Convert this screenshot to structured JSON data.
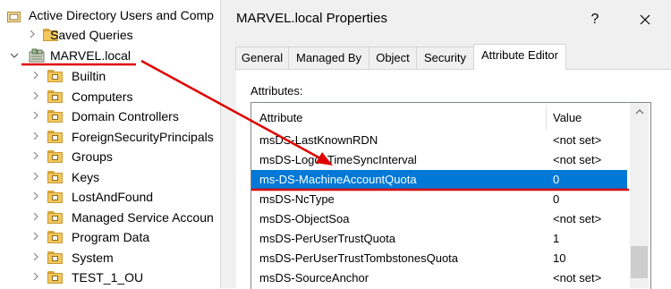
{
  "tree": {
    "root_label": "Active Directory Users and Comp",
    "saved_queries_label": "Saved Queries",
    "domain_label": "MARVEL.local",
    "children": [
      {
        "label": "Builtin"
      },
      {
        "label": "Computers"
      },
      {
        "label": "Domain Controllers"
      },
      {
        "label": "ForeignSecurityPrincipals"
      },
      {
        "label": "Groups"
      },
      {
        "label": "Keys"
      },
      {
        "label": "LostAndFound"
      },
      {
        "label": "Managed Service Accoun"
      },
      {
        "label": "Program Data"
      },
      {
        "label": "System"
      },
      {
        "label": "TEST_1_OU"
      }
    ]
  },
  "dialog": {
    "title": "MARVEL.local Properties",
    "help_label": "?",
    "tabs": [
      {
        "label": "General"
      },
      {
        "label": "Managed By"
      },
      {
        "label": "Object"
      },
      {
        "label": "Security"
      },
      {
        "label": "Attribute Editor"
      }
    ],
    "attributes_caption": "Attributes:",
    "columns": {
      "attribute": "Attribute",
      "value": "Value"
    },
    "rows": [
      {
        "attribute": "msDS-LastKnownRDN",
        "value": "<not set>"
      },
      {
        "attribute": "msDS-LogonTimeSyncInterval",
        "value": "<not set>"
      },
      {
        "attribute": "ms-DS-MachineAccountQuota",
        "value": "0"
      },
      {
        "attribute": "msDS-NcType",
        "value": "0"
      },
      {
        "attribute": "msDS-ObjectSoa",
        "value": "<not set>"
      },
      {
        "attribute": "msDS-PerUserTrustQuota",
        "value": "1"
      },
      {
        "attribute": "msDS-PerUserTrustTombstonesQuota",
        "value": "10"
      },
      {
        "attribute": "msDS-SourceAnchor",
        "value": "<not set>"
      }
    ]
  },
  "colors": {
    "selection": "#0078d7",
    "annotation": "#e00000",
    "folder": "#f2c75c"
  }
}
